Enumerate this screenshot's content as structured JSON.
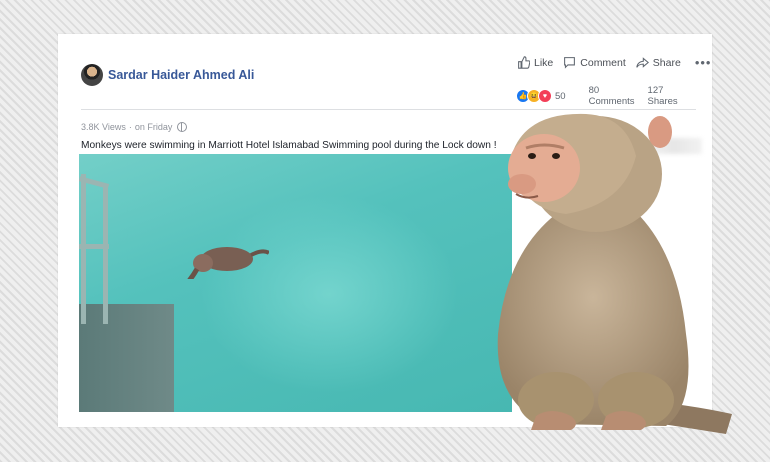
{
  "post": {
    "author": "Sardar Haider Ahmed Ali",
    "actions": {
      "like": "Like",
      "comment": "Comment",
      "share": "Share",
      "more": "•••"
    },
    "stats": {
      "reactions": "50",
      "comments": "80 Comments",
      "shares": "127 Shares"
    },
    "meta": {
      "views": "3.8K Views",
      "separator": "·",
      "time": "on Friday"
    },
    "caption": "Monkeys were swimming in Marriott Hotel Islamabad Swimming pool during the Lock down !"
  },
  "colors": {
    "author": "#385898",
    "like": "#1877f2",
    "haha": "#f7b125",
    "love": "#f33e58"
  }
}
